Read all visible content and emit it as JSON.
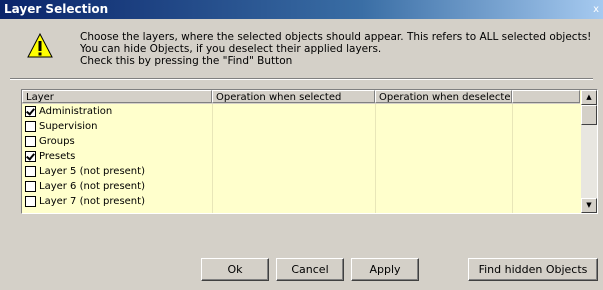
{
  "window": {
    "title": "Layer Selection",
    "close_glyph": "x"
  },
  "message": {
    "line1": "Choose the layers, where the selected objects should appear. This refers to ALL selected objects!",
    "line2": "You can hide Objects, if you deselect their applied layers.",
    "line3": "Check this by pressing the \"Find\" Button"
  },
  "icons": {
    "warning": "warning-icon",
    "warning_color": "#ffff00"
  },
  "grid": {
    "columns": [
      "Layer",
      "Operation when selected",
      "Operation when deselected"
    ],
    "rows": [
      {
        "label": "Administration",
        "checked": true
      },
      {
        "label": "Supervision",
        "checked": false
      },
      {
        "label": "Groups",
        "checked": false
      },
      {
        "label": "Presets",
        "checked": true
      },
      {
        "label": "Layer 5 (not present)",
        "checked": false
      },
      {
        "label": "Layer 6 (not present)",
        "checked": false
      },
      {
        "label": "Layer 7 (not present)",
        "checked": false
      }
    ],
    "background": "#ffffcc"
  },
  "buttons": {
    "ok": "Ok",
    "cancel": "Cancel",
    "apply": "Apply",
    "find": "Find hidden Objects"
  }
}
